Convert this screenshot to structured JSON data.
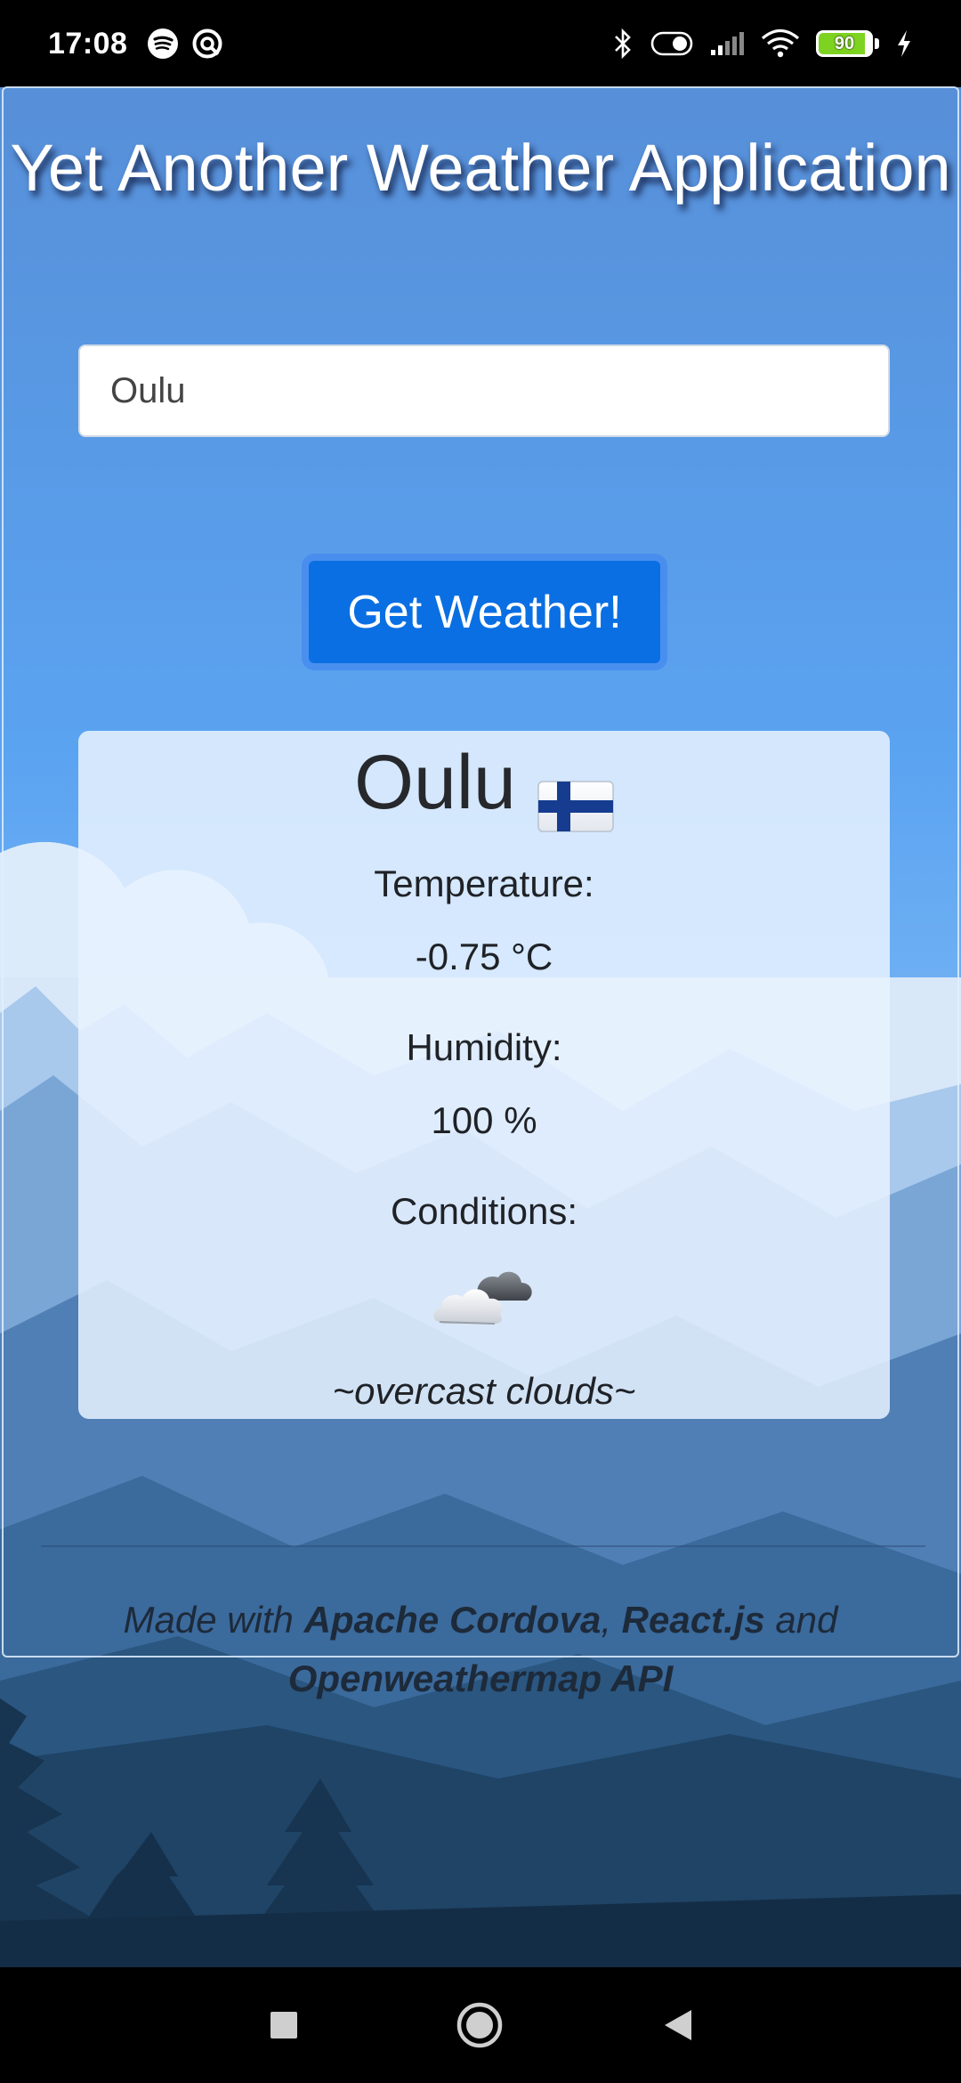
{
  "status_bar": {
    "time": "17:08",
    "battery_level": "90",
    "battery_fraction": 0.9,
    "left_icons": [
      "spotify-icon",
      "vpn-icon"
    ],
    "right_icons": [
      "bluetooth-icon",
      "toggle-icon",
      "signal-icon",
      "wifi-icon",
      "battery-icon",
      "charging-icon"
    ]
  },
  "app": {
    "title": "Yet Another Weather Application",
    "search": {
      "value": "Oulu"
    },
    "button_label": "Get Weather!",
    "weather": {
      "city": "Oulu",
      "country_flag": "finland-flag-icon",
      "temperature_label": "Temperature:",
      "temperature_value": "-0.75 °C",
      "humidity_label": "Humidity:",
      "humidity_value": "100 %",
      "conditions_label": "Conditions:",
      "condition_icon": "overcast-clouds-icon",
      "condition_description": "~overcast clouds~"
    },
    "footer": {
      "prefix": "Made with ",
      "tech1": "Apache Cordova",
      "sep1": ", ",
      "tech2": "React.js",
      "sep2": " and",
      "tech3": "Openweathermap API"
    }
  },
  "colors": {
    "sky_top": "#5b93dc",
    "sky_mid": "#5aa2f0",
    "button": "#0a6fe3",
    "mountain_dark": "#1c4162"
  },
  "nav_bar": {
    "icons": [
      "recents-square-icon",
      "home-circle-icon",
      "back-triangle-icon"
    ]
  }
}
